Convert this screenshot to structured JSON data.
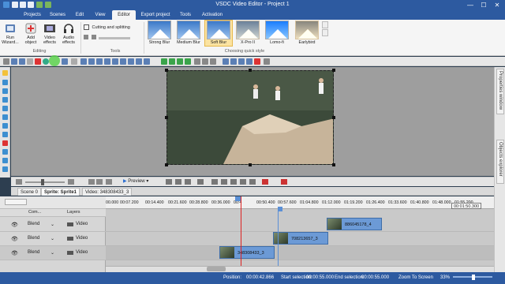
{
  "window": {
    "title": "VSDC Video Editor - Project 1",
    "minimize_glyph": "—",
    "maximize_glyph": "☐",
    "close_glyph": "✕"
  },
  "menu": {
    "tabs": [
      "Projects",
      "Scenes",
      "Edit",
      "View",
      "Editor",
      "Export project",
      "Tools",
      "Activation"
    ],
    "active": "Editor"
  },
  "ribbon": {
    "run_wizard": "Run Wizard...",
    "add_object": "Add object",
    "video_effects": "Video effects",
    "audio_effects": "Audio effects",
    "editing_label": "Editing",
    "cutting_splitting": "Cutting and splitting",
    "tools_label": "Tools",
    "quick_styles": [
      "Strong Blur",
      "Medium Blur",
      "Soft Blur",
      "X-Pro II",
      "Lomo-fi",
      "Earlybird"
    ],
    "selected_style": "Soft Blur",
    "quick_style_label": "Choosing quick style"
  },
  "right_panels": {
    "properties": "Properties window",
    "objects": "Objects explorer"
  },
  "preview_bar": {
    "preview_label": "Preview"
  },
  "timeline_tabs": [
    "Scene 0",
    "Sprite: Sprite1",
    "Video: 348308433_3"
  ],
  "timeline_tabs_active": "Sprite: Sprite1",
  "timeline_header": {
    "com_col": "Com...",
    "layers_col": "Layers"
  },
  "ruler_ticks": [
    "00.000",
    "00:07.200",
    "00:14.400",
    "00:21.600",
    "00:28.800",
    "00:36.000",
    "00:4",
    "00:50.400",
    "00:57.600",
    "01:04.800",
    "01:12.000",
    "01:19.200",
    "01:26.400",
    "01:33.600",
    "01:40.800",
    "01:48.000",
    "01:55.200"
  ],
  "playhead_time": "00:4",
  "end_time": "00:01:50.300",
  "layers": [
    {
      "blend": "Blend",
      "name": "Video",
      "clip": "886045178_4"
    },
    {
      "blend": "Blend",
      "name": "Video",
      "clip": "708213657_3"
    },
    {
      "blend": "Blend",
      "name": "Video",
      "clip": "348308433_3"
    }
  ],
  "status": {
    "position_label": "Position:",
    "position_value": "00:00:42.866",
    "start_sel_label": "Start selection:",
    "start_sel_value": "00:00:55.000",
    "end_sel_label": "End selection:",
    "end_sel_value": "00:00:55.000",
    "zoom_label": "Zoom To Screen",
    "zoom_value": "33%"
  }
}
